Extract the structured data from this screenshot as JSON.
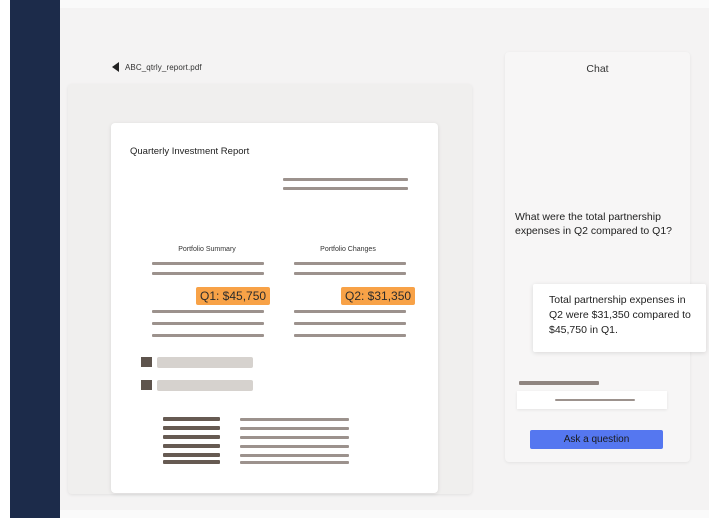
{
  "file": {
    "name": "ABC_qtrly_report.pdf"
  },
  "document": {
    "title": "Quarterly Investment Report",
    "columns": [
      {
        "label": "Portfolio Summary",
        "highlight": "Q1: $45,750"
      },
      {
        "label": "Portfolio Changes",
        "highlight": "Q2: $31,350"
      }
    ]
  },
  "chat": {
    "title": "Chat",
    "messages": [
      {
        "role": "user",
        "text": "What were the total partnership expenses in Q2 compared to Q1?"
      },
      {
        "role": "assistant",
        "text": "Total partnership expenses in Q2 were $31,350 compared to $45,750 in Q1."
      }
    ],
    "ask_button": "Ask a question"
  },
  "colors": {
    "sidebar": "#1c2b4a",
    "highlight": "#f8a247",
    "button": "#5577f0"
  },
  "icons": {
    "back": "triangle-left-icon"
  }
}
